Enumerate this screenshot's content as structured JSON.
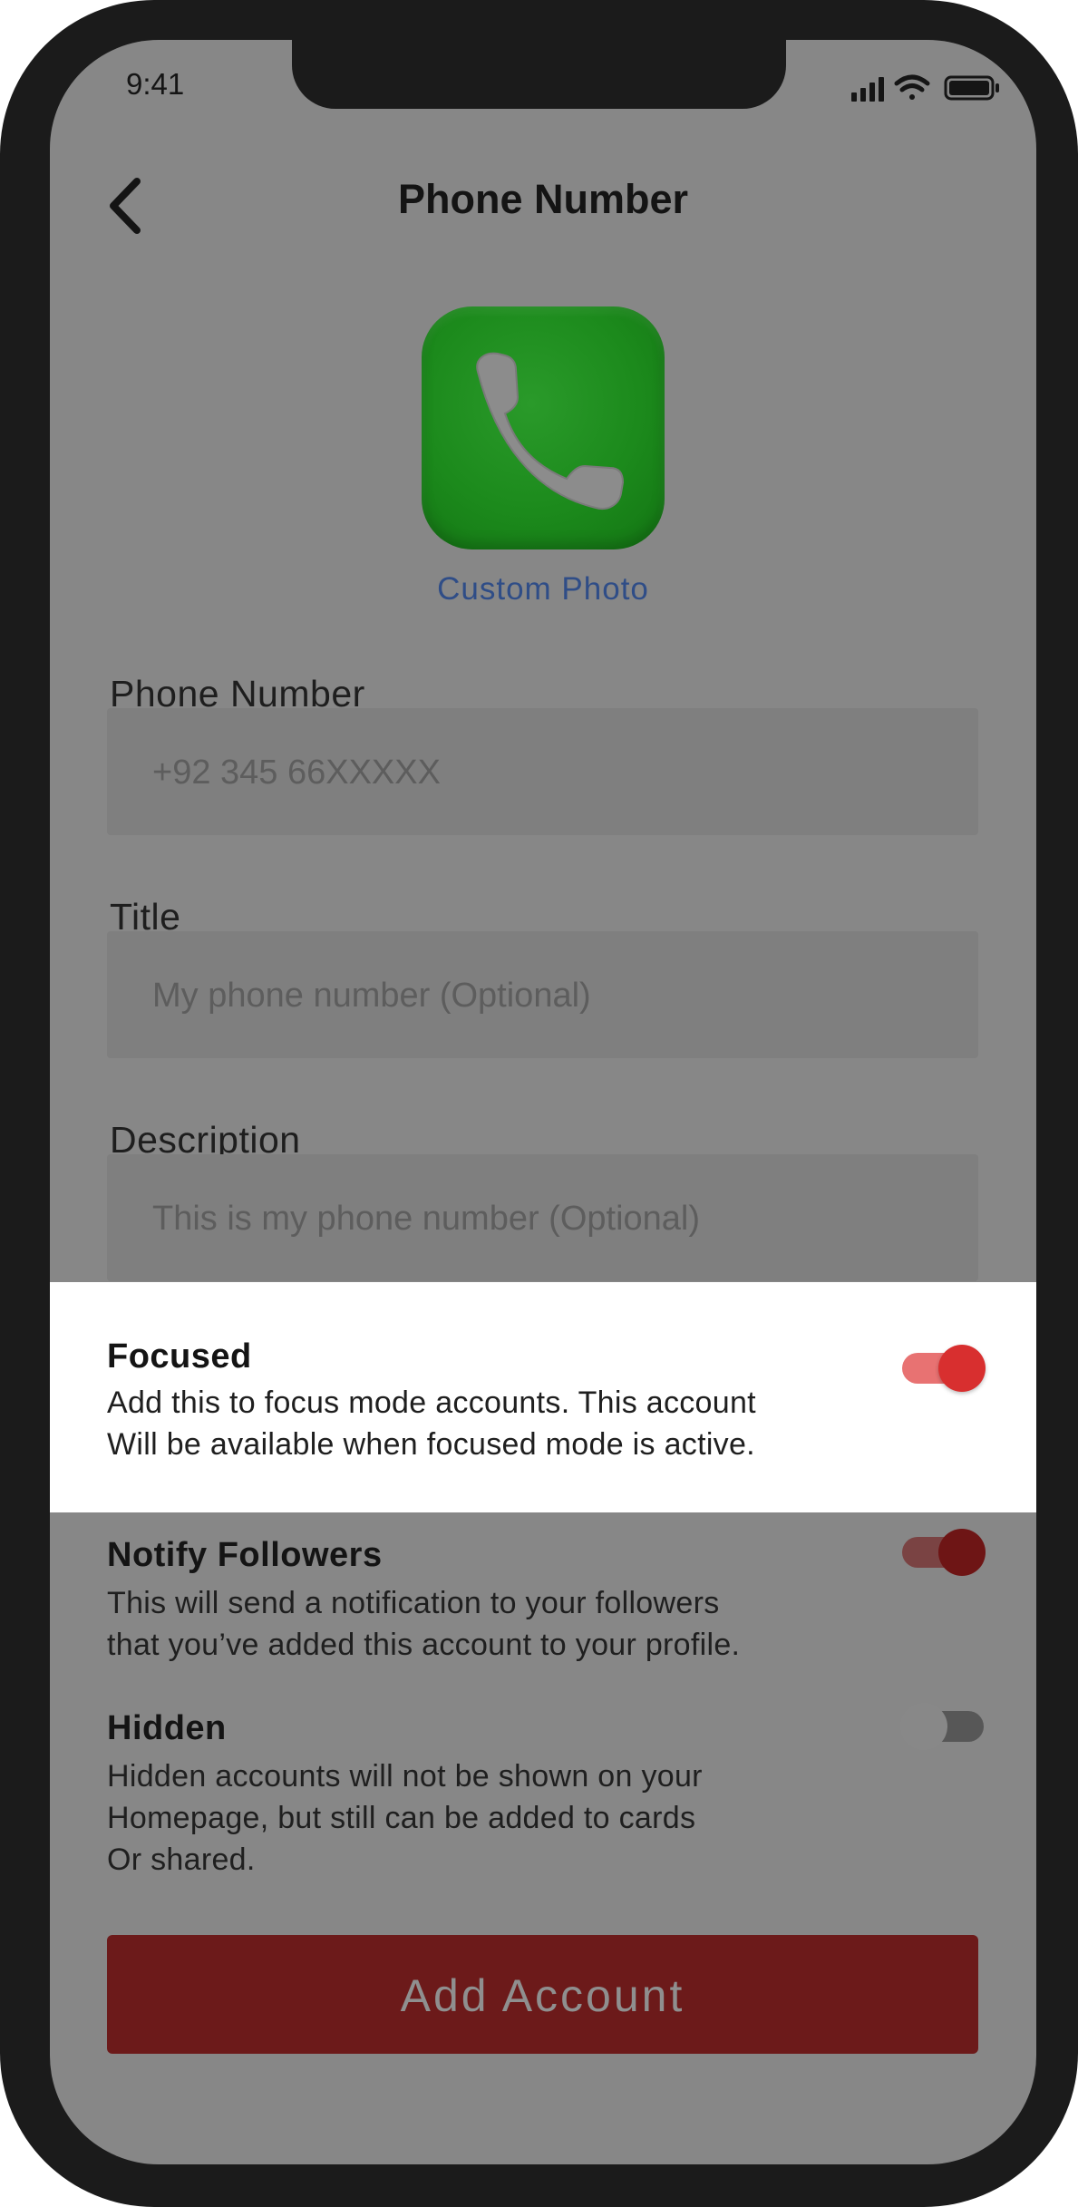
{
  "status_bar": {
    "time": "9:41"
  },
  "header": {
    "title": "Phone Number"
  },
  "photo": {
    "label": "Custom Photo"
  },
  "fields": [
    {
      "label": "Phone Number",
      "placeholder": "+92 345 66XXXXX"
    },
    {
      "label": "Title",
      "placeholder": "My phone number (Optional)"
    },
    {
      "label": "Description",
      "placeholder": "This is my phone number (Optional)"
    }
  ],
  "options": {
    "focused": {
      "title": "Focused",
      "line1": "Add this to focus mode accounts. This account",
      "line2": "Will be available when focused mode is active.",
      "enabled": true
    },
    "notify": {
      "title": "Notify Followers",
      "line1": "This will send a notification to your followers",
      "line2": "that you’ve added this account to your profile.",
      "enabled": true
    },
    "hidden": {
      "title": "Hidden",
      "line1": "Hidden accounts will not be shown on your",
      "line2": "Homepage, but still can be added to cards",
      "line3": "Or shared.",
      "enabled": false
    }
  },
  "actions": {
    "add_account": "Add Account"
  },
  "colors": {
    "accent_red": "#d82f2f",
    "button_red": "#6c1a1a",
    "link_blue": "#2f4d87",
    "icon_green": "#1c8a1c",
    "overlay": "#878787"
  }
}
